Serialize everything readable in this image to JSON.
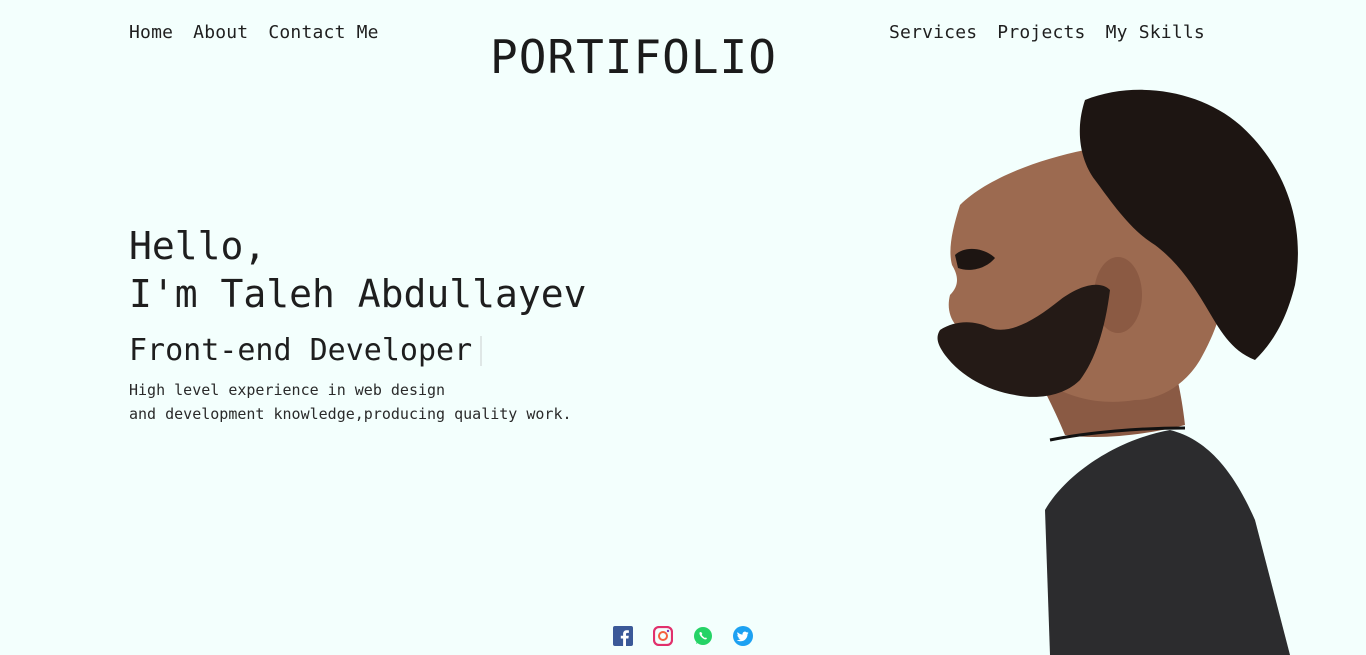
{
  "nav": {
    "left": [
      {
        "label": "Home"
      },
      {
        "label": "About"
      },
      {
        "label": "Contact Me"
      }
    ],
    "right": [
      {
        "label": "Services"
      },
      {
        "label": "Projects"
      },
      {
        "label": "My Skills"
      }
    ]
  },
  "brand": "PORTIFOLIO",
  "hero": {
    "greeting_line1": "Hello,",
    "greeting_line2": "I'm Taleh Abdullayev",
    "role": "Front-end Developer",
    "desc_line1": "High level experience in web design",
    "desc_line2": "and development knowledge,producing quality work."
  },
  "social": [
    {
      "icon": "facebook-icon",
      "color": "#3b5998"
    },
    {
      "icon": "instagram-icon",
      "color": "#e1306c"
    },
    {
      "icon": "whatsapp-icon",
      "color": "#25d366"
    },
    {
      "icon": "twitter-icon",
      "color": "#1da1f2"
    }
  ],
  "colors": {
    "background": "#f3fffd",
    "text": "#1f1f1f"
  }
}
